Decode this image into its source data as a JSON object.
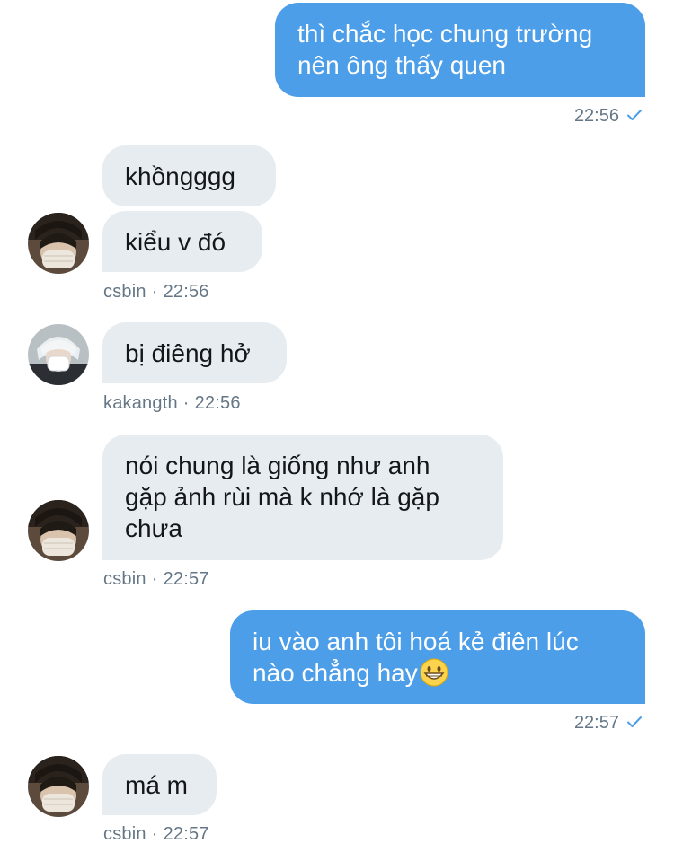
{
  "messages": [
    {
      "id": "m1",
      "dir": "out",
      "text": "thì chắc học chung trường\nnên ông thấy quen",
      "time": "22:56"
    },
    {
      "id": "m2",
      "dir": "in",
      "text": "khồngggg"
    },
    {
      "id": "m3",
      "dir": "in",
      "text": "kiểu v đó",
      "user": "csbin",
      "time": "22:56"
    },
    {
      "id": "m4",
      "dir": "in",
      "text": "bị điêng hở",
      "user": "kakangth",
      "time": "22:56"
    },
    {
      "id": "m5",
      "dir": "in",
      "text": "nói chung là giống như anh\ngặp ảnh rùi mà k nhớ là gặp\nchưa",
      "user": "csbin",
      "time": "22:57"
    },
    {
      "id": "m6",
      "dir": "out",
      "text": "iu vào anh tôi hoá kẻ điên lúc\nnào chẳng hay",
      "emoji": "grinning-face-emoji",
      "time": "22:57"
    },
    {
      "id": "m7",
      "dir": "in",
      "text": "má m",
      "user": "csbin",
      "time": "22:57"
    }
  ],
  "meta_separator": "·",
  "icons": {
    "read_receipt": "check-icon",
    "avatar_csbin": "avatar-csbin",
    "avatar_kakangth": "avatar-kakangth"
  },
  "colors": {
    "outgoing_bubble": "#4d9ee8",
    "incoming_bubble": "#e6ecf0",
    "meta_text": "#657786",
    "check": "#4d9ee8"
  }
}
